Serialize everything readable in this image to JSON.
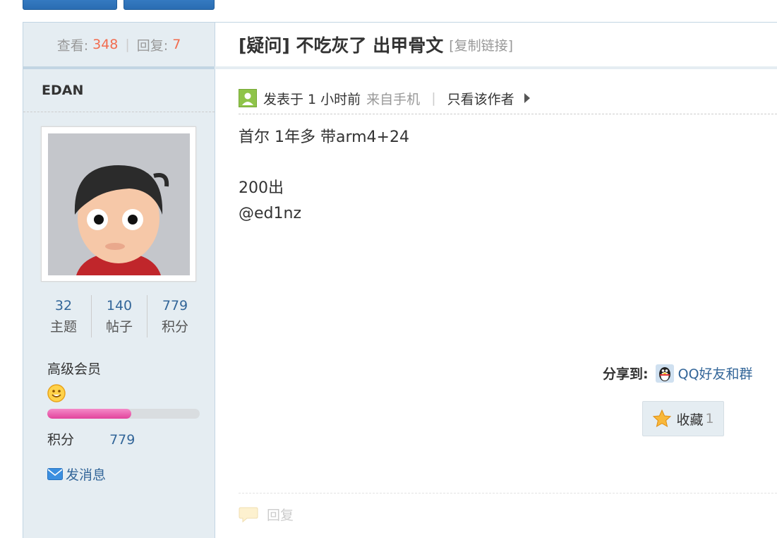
{
  "stats": {
    "view_label": "查看:",
    "view_count": "348",
    "reply_label": "回复:",
    "reply_count": "7"
  },
  "user": {
    "name": "EDAN",
    "topics": "32",
    "topics_label": "主题",
    "posts": "140",
    "posts_label": "帖子",
    "points": "779",
    "points_label": "积分",
    "level": "高级会员",
    "level_progress": 0.55,
    "credit_label": "积分",
    "credit_value": "779",
    "message_label": "发消息"
  },
  "thread": {
    "title": "[疑问] 不吃灰了 出甲骨文",
    "copy_link": "[复制链接]",
    "posted": "发表于 1 小时前",
    "source": "来自手机",
    "author_only": "只看该作者",
    "body_lines": [
      "首尔 1年多 带arm4+24",
      "",
      "200出",
      "@ed1nz"
    ]
  },
  "share": {
    "label": "分享到:",
    "target": "QQ好友和群"
  },
  "favorite": {
    "label": "收藏",
    "count": "1"
  },
  "reply": {
    "label": "回复"
  },
  "colors": {
    "accent": "#336699",
    "highlight": "#f26c4f",
    "sidebar_bg": "#e5edf2",
    "border": "#c2d5e3"
  }
}
